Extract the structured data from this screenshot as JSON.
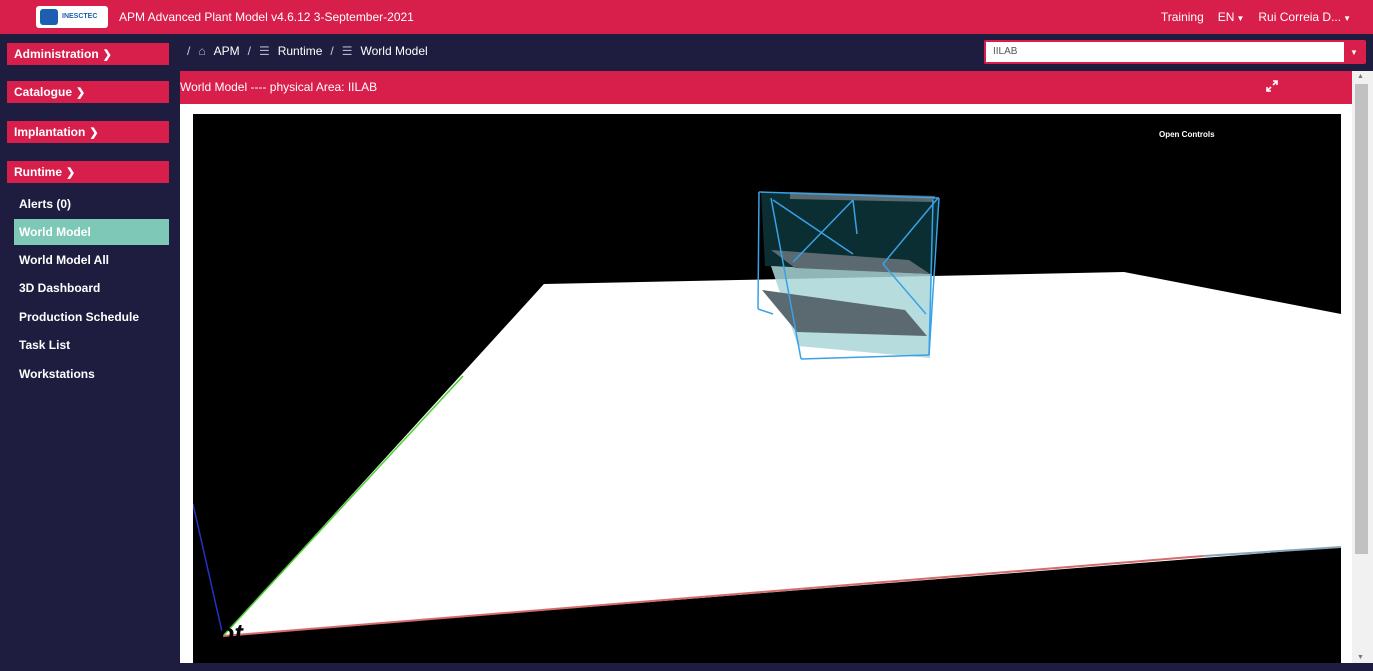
{
  "header": {
    "logo_text": "INESCTEC",
    "app_title": "APM Advanced Plant Model   v4.6.12   3-September-2021",
    "training": "Training",
    "language": "EN",
    "user": "Rui Correia D..."
  },
  "breadcrumb": {
    "root_sep": "/",
    "items": [
      "APM",
      "Runtime",
      "World Model"
    ],
    "sep": "/"
  },
  "area_select": {
    "value": "IILAB"
  },
  "sidebar": {
    "sections": [
      {
        "label": "Administration",
        "expanded": false
      },
      {
        "label": "Catalogue",
        "expanded": false
      },
      {
        "label": "Implantation",
        "expanded": false
      },
      {
        "label": "Runtime",
        "expanded": true
      }
    ],
    "runtime_items": [
      {
        "label": "Alerts (0)",
        "active": false
      },
      {
        "label": "World Model",
        "active": true
      },
      {
        "label": "World Model All",
        "active": false
      },
      {
        "label": "3D Dashboard",
        "active": false
      },
      {
        "label": "Production Schedule",
        "active": false
      },
      {
        "label": "Task List",
        "active": false
      },
      {
        "label": "Workstations",
        "active": false
      }
    ]
  },
  "panel": {
    "title": "World Model ---- physical Area: IILAB",
    "open_controls": "Open Controls",
    "scene_text": "RefRobot"
  },
  "colors": {
    "brand": "#d81e4b",
    "nav_bg": "#1f1d3f",
    "active": "#7ec8b8"
  }
}
